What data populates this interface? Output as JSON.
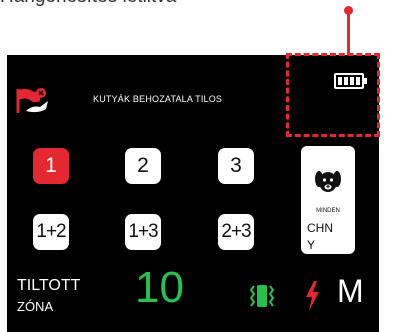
{
  "caption": "Hangerlesítés letiltva",
  "screen": {
    "no_dogs_text": "KUTYÁK BEHOZATALA TILOS",
    "keys": [
      "1",
      "2",
      "3",
      "1+2",
      "1+3",
      "2+3"
    ],
    "active_key": "1",
    "mode_card": {
      "all_label": "MINDEN",
      "code": "CHNY",
      "icon": "dog-face-icon"
    },
    "zone_label_line1": "TILTOTT",
    "zone_label_line2": "ZÓNA",
    "zone_value": "10",
    "level": "M",
    "battery_level": 1.0,
    "icons": [
      "flag-icon",
      "battery-icon",
      "vibration-icon",
      "shock-icon"
    ]
  },
  "colors": {
    "accent_red": "#e5272f",
    "value_green": "#27c24a"
  }
}
